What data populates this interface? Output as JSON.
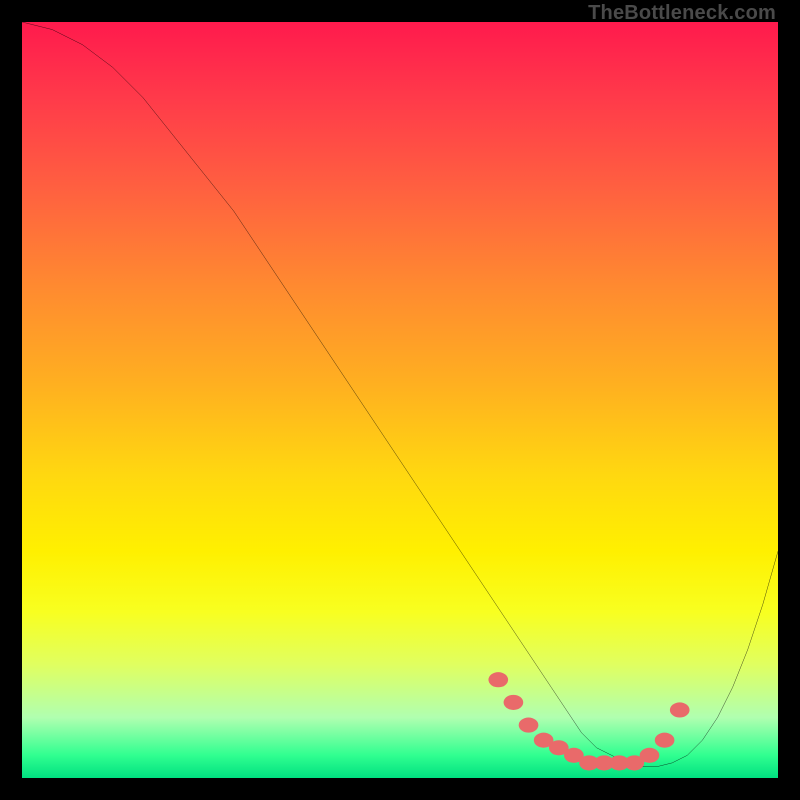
{
  "watermark": "TheBottleneck.com",
  "chart_data": {
    "type": "line",
    "title": "",
    "xlabel": "",
    "ylabel": "",
    "xlim": [
      0,
      100
    ],
    "ylim": [
      0,
      100
    ],
    "series": [
      {
        "name": "curve",
        "x": [
          0,
          4,
          8,
          12,
          16,
          20,
          24,
          28,
          32,
          36,
          40,
          44,
          48,
          52,
          56,
          60,
          62,
          64,
          66,
          68,
          70,
          72,
          74,
          76,
          78,
          80,
          82,
          84,
          86,
          88,
          90,
          92,
          94,
          96,
          98,
          100
        ],
        "y": [
          100,
          99,
          97,
          94,
          90,
          85,
          80,
          75,
          69,
          63,
          57,
          51,
          45,
          39,
          33,
          27,
          24,
          21,
          18,
          15,
          12,
          9,
          6,
          4,
          3,
          2,
          1.5,
          1.5,
          2,
          3,
          5,
          8,
          12,
          17,
          23,
          30
        ]
      }
    ],
    "markers": {
      "name": "optimal-region",
      "color": "#e96a6a",
      "x": [
        63,
        65,
        67,
        69,
        71,
        73,
        75,
        77,
        79,
        81,
        83,
        85,
        87
      ],
      "y": [
        13,
        10,
        7,
        5,
        4,
        3,
        2,
        2,
        2,
        2,
        3,
        5,
        9
      ]
    },
    "gradient_stops": [
      {
        "pos": 0.0,
        "color": "#ff1a4d"
      },
      {
        "pos": 0.35,
        "color": "#ff8a30"
      },
      {
        "pos": 0.7,
        "color": "#fff000"
      },
      {
        "pos": 0.92,
        "color": "#b0ffb0"
      },
      {
        "pos": 1.0,
        "color": "#00e080"
      }
    ]
  }
}
